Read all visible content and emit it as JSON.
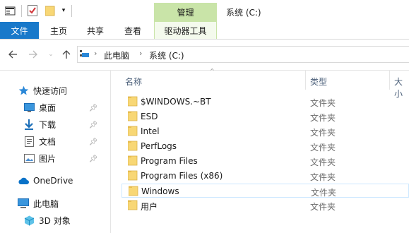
{
  "title_bar": {
    "context_tab_group": "管理",
    "window_title": "系统 (C:)"
  },
  "ribbon": {
    "tabs": [
      "文件",
      "主页",
      "共享",
      "查看",
      "驱动器工具"
    ]
  },
  "address_bar": {
    "path": [
      "此电脑",
      "系统 (C:)"
    ]
  },
  "nav_pane": {
    "quick_access": "快速访问",
    "pinned": [
      {
        "label": "桌面",
        "icon": "desktop-icon"
      },
      {
        "label": "下载",
        "icon": "download-icon"
      },
      {
        "label": "文档",
        "icon": "document-icon"
      },
      {
        "label": "图片",
        "icon": "picture-icon"
      }
    ],
    "onedrive": "OneDrive",
    "this_pc": "此电脑",
    "objects_3d": "3D 对象"
  },
  "file_list": {
    "columns": [
      "名称",
      "类型",
      "大小"
    ],
    "rows": [
      {
        "name": "$WINDOWS.~BT",
        "type": "文件夹"
      },
      {
        "name": "ESD",
        "type": "文件夹"
      },
      {
        "name": "Intel",
        "type": "文件夹"
      },
      {
        "name": "PerfLogs",
        "type": "文件夹"
      },
      {
        "name": "Program Files",
        "type": "文件夹"
      },
      {
        "name": "Program Files (x86)",
        "type": "文件夹"
      },
      {
        "name": "Windows",
        "type": "文件夹",
        "selected": true
      },
      {
        "name": "用户",
        "type": "文件夹"
      }
    ]
  },
  "colors": {
    "file_tab": "#1979ca",
    "context_tab": "#c9e4a8",
    "folder": "#f8d775",
    "selection_border": "#cde8ff"
  }
}
